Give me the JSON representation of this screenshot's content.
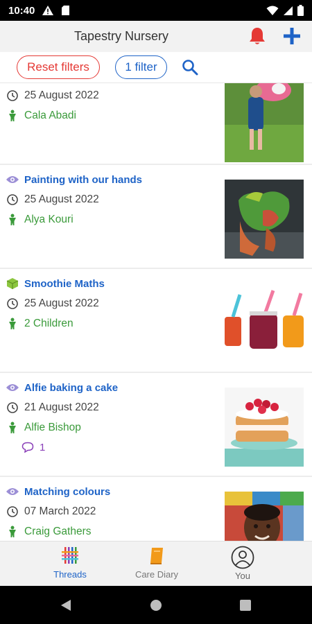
{
  "status_bar": {
    "time": "10:40"
  },
  "app_bar": {
    "title": "Tapestry Nursery",
    "bell_icon": "bell-icon",
    "plus_icon": "plus-icon"
  },
  "filters": {
    "reset_label": "Reset filters",
    "filter_label": "1 filter",
    "search_icon": "search-icon"
  },
  "colors": {
    "accent_blue": "#1e63c7",
    "accent_red": "#e53935",
    "child_green": "#3a9a3a",
    "comment_purple": "#8a3fb8"
  },
  "posts": [
    {
      "title": "",
      "date": "25 August 2022",
      "child": "Cala Abadi",
      "comments": ""
    },
    {
      "title": "Painting with our hands",
      "date": "25 August 2022",
      "child": "Alya Kouri",
      "comments": ""
    },
    {
      "title": "Smoothie Maths",
      "date": "25 August 2022",
      "child": "2 Children",
      "comments": ""
    },
    {
      "title": "Alfie baking a cake",
      "date": "21 August 2022",
      "child": "Alfie Bishop",
      "comments": "1"
    },
    {
      "title": "Matching colours",
      "date": "07 March 2022",
      "child": "Craig Gathers",
      "comments": ""
    }
  ],
  "bottom_nav": [
    {
      "label": "Threads",
      "active": true
    },
    {
      "label": "Care Diary",
      "active": false
    },
    {
      "label": "You",
      "active": false
    }
  ]
}
